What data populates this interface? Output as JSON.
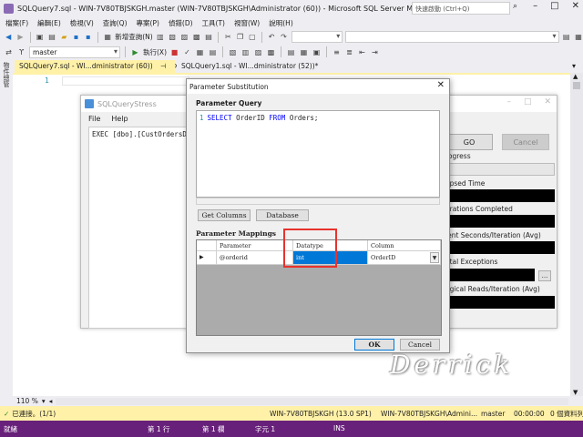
{
  "window": {
    "title": "SQLQuery7.sql - WIN-7V80TBJSKGH.master (WIN-7V80TBJSKGH\\Administrator (60)) - Microsoft SQL Server Managem...",
    "quick_launch_placeholder": "快速啟動 (Ctrl+Q)"
  },
  "menu": [
    "檔案(F)",
    "編輯(E)",
    "檢視(V)",
    "查詢(Q)",
    "專案(P)",
    "偵錯(D)",
    "工具(T)",
    "視窗(W)",
    "說明(H)"
  ],
  "toolbar": {
    "new_query": "新增查詢(N)",
    "database": "master",
    "execute": "執行(X)"
  },
  "left_panel_label": "物件總管",
  "tabs": [
    {
      "label": "SQLQuery7.sql - WI...dministrator (60))",
      "active": true
    },
    {
      "label": "SQLQuery1.sql - WI...dministrator (52))*",
      "active": false
    }
  ],
  "editor": {
    "line_number": "1"
  },
  "zoom": "110 %",
  "infobar": {
    "connected": "已連接。(1/1)",
    "server": "WIN-7V80TBJSKGH (13.0 SP1)",
    "user": "WIN-7V80TBJSKGH\\Admini...",
    "db": "master",
    "time": "00:00:00",
    "rows": "0 個資料列"
  },
  "status": {
    "ready": "就緒",
    "line": "第 1 行",
    "col": "第 1 欄",
    "ch": "字元 1",
    "ins": "INS"
  },
  "sqs": {
    "title": "SQLQueryStress",
    "menu": [
      "File",
      "Help"
    ],
    "query": "EXEC [dbo].[CustOrdersD",
    "go": "GO",
    "cancel": "Cancel",
    "labels": {
      "progress": "rogress",
      "elapsed": "apsed Time",
      "iterations": "erations Completed",
      "client_seconds": "ient Seconds/Iteration (Avg)",
      "exceptions": "otal Exceptions",
      "logical_reads": "ogical Reads/Iteration (Avg)"
    },
    "dots": "..."
  },
  "dialog": {
    "title": "Parameter Substitution",
    "query_label": "Parameter Query",
    "query_line": "1",
    "query_select": "SELECT",
    "query_mid": " OrderID ",
    "query_from": "FROM",
    "query_end": " Orders;",
    "get_columns": "Get Columns",
    "database": "Database",
    "mappings_label": "Parameter Mappings",
    "grid": {
      "headers": [
        "Parameter",
        "Datatype",
        "Column"
      ],
      "row_marker": "▶",
      "row": {
        "parameter": "@orderid",
        "datatype": "int",
        "column": "OrderID"
      }
    },
    "ok": "OK",
    "cancel": "Cancel"
  },
  "watermark": "Derrick"
}
